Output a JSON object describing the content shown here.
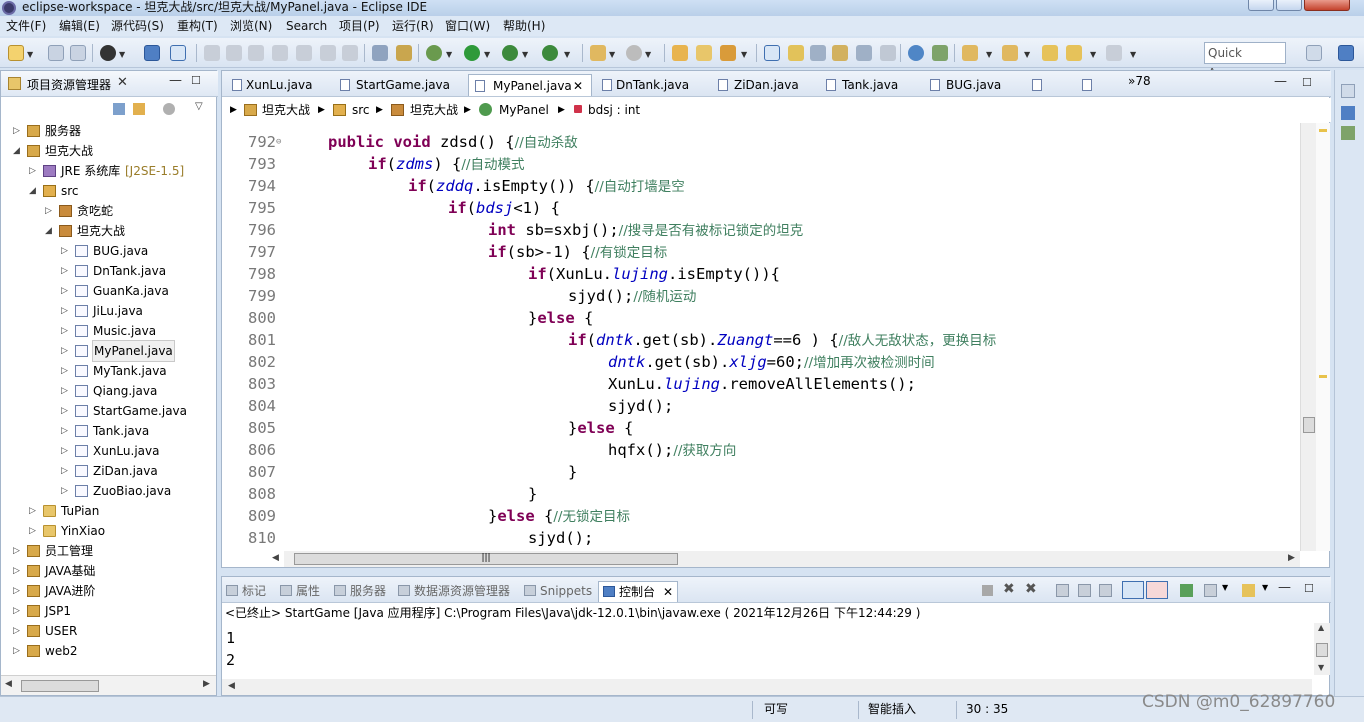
{
  "window": {
    "title": "eclipse-workspace - 坦克大战/src/坦克大战/MyPanel.java - Eclipse IDE"
  },
  "menu": [
    "文件(F)",
    "编辑(E)",
    "源代码(S)",
    "重构(T)",
    "浏览(N)",
    "Search",
    "项目(P)",
    "运行(R)",
    "窗口(W)",
    "帮助(H)"
  ],
  "toolbar": {
    "quick_access": "Quick Access"
  },
  "project_explorer": {
    "title": "项目资源管理器",
    "items": [
      {
        "label": "服务器",
        "level": 0,
        "expanded": false
      },
      {
        "label": "坦克大战",
        "level": 0,
        "expanded": true
      },
      {
        "label": "JRE 系统库",
        "suffix": "[J2SE-1.5]",
        "level": 1,
        "expanded": false
      },
      {
        "label": "src",
        "level": 1,
        "expanded": true
      },
      {
        "label": "贪吃蛇",
        "level": 2,
        "expanded": false
      },
      {
        "label": "坦克大战",
        "level": 2,
        "expanded": true
      },
      {
        "label": "BUG.java",
        "level": 3
      },
      {
        "label": "DnTank.java",
        "level": 3
      },
      {
        "label": "GuanKa.java",
        "level": 3
      },
      {
        "label": "JiLu.java",
        "level": 3
      },
      {
        "label": "Music.java",
        "level": 3
      },
      {
        "label": "MyPanel.java",
        "level": 3,
        "selected": true
      },
      {
        "label": "MyTank.java",
        "level": 3
      },
      {
        "label": "Qiang.java",
        "level": 3
      },
      {
        "label": "StartGame.java",
        "level": 3
      },
      {
        "label": "Tank.java",
        "level": 3
      },
      {
        "label": "XunLu.java",
        "level": 3
      },
      {
        "label": "ZiDan.java",
        "level": 3
      },
      {
        "label": "ZuoBiao.java",
        "level": 3
      },
      {
        "label": "TuPian",
        "level": 1,
        "expanded": false
      },
      {
        "label": "YinXiao",
        "level": 1,
        "expanded": false
      },
      {
        "label": "员工管理",
        "level": 0,
        "expanded": false
      },
      {
        "label": "JAVA基础",
        "level": 0,
        "expanded": false
      },
      {
        "label": "JAVA进阶",
        "level": 0,
        "expanded": false
      },
      {
        "label": "JSP1",
        "level": 0,
        "expanded": false
      },
      {
        "label": "USER",
        "level": 0,
        "expanded": false
      },
      {
        "label": "web2",
        "level": 0,
        "expanded": false
      }
    ]
  },
  "editor": {
    "tabs": [
      "XunLu.java",
      "StartGame.java",
      "MyPanel.java",
      "DnTank.java",
      "ZiDan.java",
      "Tank.java",
      "BUG.java"
    ],
    "active_tab": "MyPanel.java",
    "overflow_count": "»78",
    "breadcrumb": [
      "坦克大战",
      "src",
      "坦克大战",
      "MyPanel",
      "bdsj : int"
    ],
    "lines": [
      {
        "num": "792",
        "segs": [
          [
            "kw",
            "public void "
          ],
          [
            "t",
            "zdsd() {"
          ],
          [
            "c",
            "//自动杀敌"
          ]
        ],
        "indent": 2
      },
      {
        "num": "793",
        "segs": [
          [
            "kw",
            "if"
          ],
          [
            "t",
            "("
          ],
          [
            "f",
            "zdms"
          ],
          [
            "t",
            ") {"
          ],
          [
            "c",
            "//自动模式"
          ]
        ],
        "indent": 4
      },
      {
        "num": "794",
        "segs": [
          [
            "kw",
            "if"
          ],
          [
            "t",
            "("
          ],
          [
            "f",
            "zddq"
          ],
          [
            "t",
            ".isEmpty()) {"
          ],
          [
            "c",
            "//自动打墙是空"
          ]
        ],
        "indent": 6
      },
      {
        "num": "795",
        "segs": [
          [
            "kw",
            "if"
          ],
          [
            "t",
            "("
          ],
          [
            "f",
            "bdsj"
          ],
          [
            "t",
            "<1) {"
          ]
        ],
        "indent": 8
      },
      {
        "num": "796",
        "segs": [
          [
            "kw",
            "int "
          ],
          [
            "t",
            "sb=sxbj();"
          ],
          [
            "c",
            "//搜寻是否有被标记锁定的坦克"
          ]
        ],
        "indent": 10
      },
      {
        "num": "797",
        "segs": [
          [
            "kw",
            "if"
          ],
          [
            "t",
            "(sb>-1) {"
          ],
          [
            "c",
            "//有锁定目标"
          ]
        ],
        "indent": 10
      },
      {
        "num": "798",
        "segs": [
          [
            "kw",
            "if"
          ],
          [
            "t",
            "(XunLu."
          ],
          [
            "f",
            "lujing"
          ],
          [
            "t",
            ".isEmpty()){"
          ]
        ],
        "indent": 12
      },
      {
        "num": "799",
        "segs": [
          [
            "t",
            "sjyd();"
          ],
          [
            "c",
            "//随机运动"
          ]
        ],
        "indent": 14
      },
      {
        "num": "800",
        "segs": [
          [
            "t",
            "}"
          ],
          [
            "kw",
            "else"
          ],
          [
            "t",
            " {"
          ]
        ],
        "indent": 12
      },
      {
        "num": "801",
        "segs": [
          [
            "kw",
            "if"
          ],
          [
            "t",
            "("
          ],
          [
            "f",
            "dntk"
          ],
          [
            "t",
            ".get(sb)."
          ],
          [
            "f",
            "Zuangt"
          ],
          [
            "t",
            "==6 ) {"
          ],
          [
            "c",
            "//敌人无敌状态，更换目标"
          ]
        ],
        "indent": 14
      },
      {
        "num": "802",
        "segs": [
          [
            "f",
            "dntk"
          ],
          [
            "t",
            ".get(sb)."
          ],
          [
            "f",
            "xljg"
          ],
          [
            "t",
            "=60;"
          ],
          [
            "c",
            "//增加再次被检测时间"
          ]
        ],
        "indent": 16
      },
      {
        "num": "803",
        "segs": [
          [
            "t",
            "XunLu."
          ],
          [
            "f",
            "lujing"
          ],
          [
            "t",
            ".removeAllElements();"
          ]
        ],
        "indent": 16
      },
      {
        "num": "804",
        "segs": [
          [
            "t",
            "sjyd();"
          ]
        ],
        "indent": 16
      },
      {
        "num": "805",
        "segs": [
          [
            "t",
            "}"
          ],
          [
            "kw",
            "else"
          ],
          [
            "t",
            " {"
          ]
        ],
        "indent": 14
      },
      {
        "num": "806",
        "segs": [
          [
            "t",
            "hqfx();"
          ],
          [
            "c",
            "//获取方向"
          ]
        ],
        "indent": 16
      },
      {
        "num": "807",
        "segs": [
          [
            "t",
            "}"
          ]
        ],
        "indent": 14
      },
      {
        "num": "808",
        "segs": [
          [
            "t",
            "}"
          ]
        ],
        "indent": 12
      },
      {
        "num": "809",
        "segs": [
          [
            "t",
            "}"
          ],
          [
            "kw",
            "else"
          ],
          [
            "t",
            " {"
          ],
          [
            "c",
            "//无锁定目标"
          ]
        ],
        "indent": 10
      },
      {
        "num": "810",
        "segs": [
          [
            "t",
            "sjyd();"
          ]
        ],
        "indent": 12
      }
    ]
  },
  "console": {
    "tabs": [
      "标记",
      "属性",
      "服务器",
      "数据源资源管理器",
      "Snippets",
      "控制台"
    ],
    "active_tab": "控制台",
    "status": "<已终止> StartGame [Java 应用程序] C:\\Program Files\\Java\\jdk-12.0.1\\bin\\javaw.exe ( 2021年12月26日 下午12:44:29 )",
    "output": [
      "1",
      "2"
    ]
  },
  "statusbar": {
    "writable": "可写",
    "insert_mode": "智能插入",
    "position": "30 : 35"
  },
  "watermark": "CSDN @m0_62897760"
}
